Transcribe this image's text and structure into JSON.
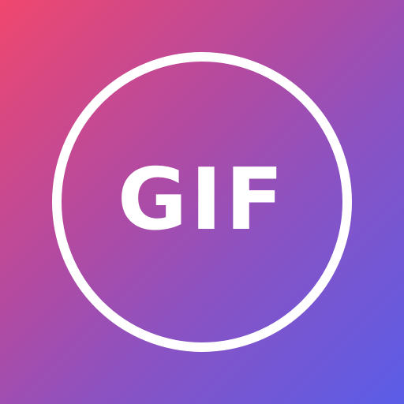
{
  "icon": {
    "label": "GIF",
    "gradient": {
      "top_left": "#f0476e",
      "bottom_right": "#5a5de8"
    },
    "ring_color": "#ffffff",
    "text_color": "#ffffff"
  }
}
